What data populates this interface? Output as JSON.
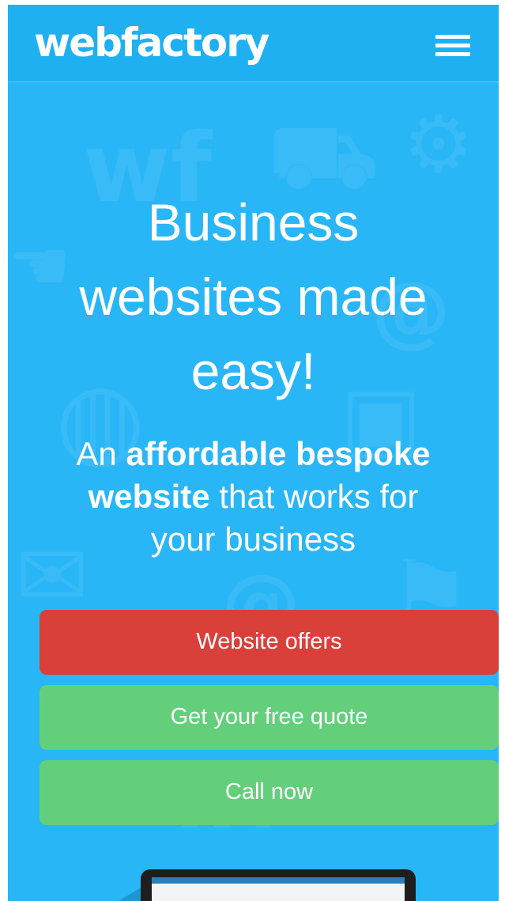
{
  "header": {
    "logo_text": "webfactory",
    "menu_icon": "hamburger-menu-icon"
  },
  "hero": {
    "title_line1": "Business",
    "title_line2": "websites made",
    "title_line3": "easy!",
    "subtitle_part1": "An ",
    "subtitle_bold1": "affordable bespoke",
    "subtitle_bold2": "website",
    "subtitle_part2": " that works for",
    "subtitle_part3": "your business"
  },
  "buttons": {
    "offers_label": "Website offers",
    "quote_label": "Get your free quote",
    "call_label": "Call now"
  },
  "colors": {
    "background": "#29b6f6",
    "header": "#1fb0f2",
    "offers_button": "#d9403a",
    "cta_button": "#63cf7b"
  }
}
